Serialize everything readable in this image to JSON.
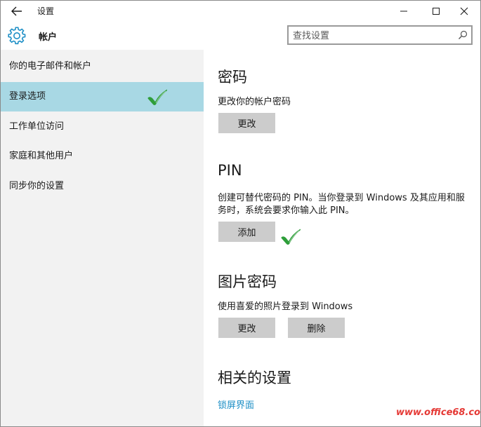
{
  "window": {
    "title": "设置",
    "controls": {
      "minimize_icon": "minimize-icon",
      "maximize_icon": "maximize-icon",
      "close_icon": "close-icon"
    }
  },
  "header": {
    "title": "帐户",
    "icon": "gear-icon"
  },
  "search": {
    "value": "",
    "placeholder": "查找设置",
    "icon": "search-icon"
  },
  "sidebar": {
    "items": [
      {
        "label": "你的电子邮件和帐户",
        "selected": false
      },
      {
        "label": "登录选项",
        "selected": true
      },
      {
        "label": "工作单位访问",
        "selected": false
      },
      {
        "label": "家庭和其他用户",
        "selected": false
      },
      {
        "label": "同步你的设置",
        "selected": false
      }
    ]
  },
  "main": {
    "password": {
      "title": "密码",
      "desc": "更改你的帐户密码",
      "change_label": "更改"
    },
    "pin": {
      "title": "PIN",
      "desc": "创建可替代密码的 PIN。当你登录到 Windows 及其应用和服务时，系统会要求你输入此 PIN。",
      "add_label": "添加"
    },
    "picture_password": {
      "title": "图片密码",
      "desc": "使用喜爱的照片登录到 Windows",
      "change_label": "更改",
      "remove_label": "删除"
    },
    "related": {
      "title": "相关的设置",
      "lock_screen_link": "锁屏界面"
    }
  },
  "annotations": {
    "checkmark_color": "#2e9e3a"
  },
  "watermark": {
    "text": "www.office68.com",
    "color": "#e53935"
  },
  "colors": {
    "selected_bg": "#a8d8e4",
    "sidebar_bg": "#f2f2f2",
    "button_bg": "#cccccc",
    "link": "#1e8fc6"
  }
}
